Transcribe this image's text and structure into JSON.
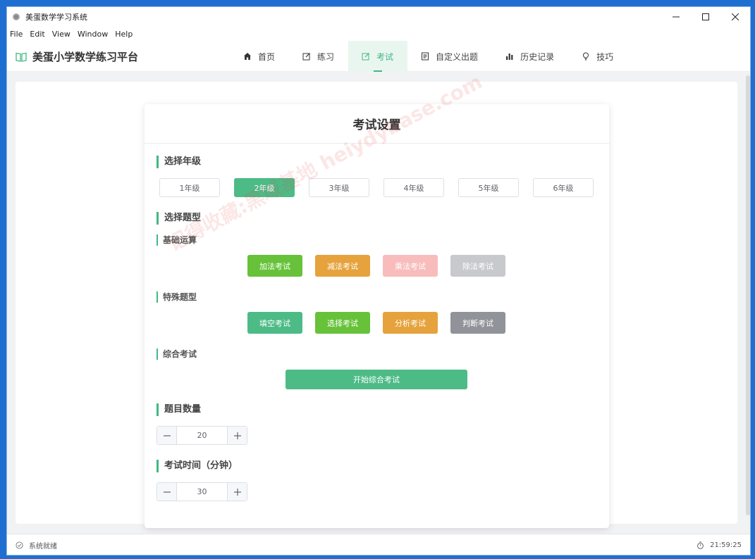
{
  "window": {
    "title": "美蛋数学学习系统"
  },
  "menu": [
    "File",
    "Edit",
    "View",
    "Window",
    "Help"
  ],
  "brand": {
    "name": "美蛋小学数学练习平台"
  },
  "nav": [
    {
      "label": "首页",
      "icon": "home-icon"
    },
    {
      "label": "练习",
      "icon": "edit-icon"
    },
    {
      "label": "考试",
      "icon": "edit-icon",
      "active": true
    },
    {
      "label": "自定义出题",
      "icon": "document-icon"
    },
    {
      "label": "历史记录",
      "icon": "bar-chart-icon"
    },
    {
      "label": "技巧",
      "icon": "lightbulb-icon"
    }
  ],
  "card": {
    "title": "考试设置",
    "grade_section": "选择年级",
    "grades": [
      "1年级",
      "2年级",
      "3年级",
      "4年级",
      "5年级",
      "6年级"
    ],
    "selected_grade": "2年级",
    "type_section": "选择题型",
    "basic": {
      "title": "基础运算",
      "buttons": [
        {
          "label": "加法考试",
          "color": "#67c23a"
        },
        {
          "label": "减法考试",
          "color": "#e6a23c"
        },
        {
          "label": "乘法考试",
          "color": "#f8bcbc"
        },
        {
          "label": "除法考试",
          "color": "#c8c9cc"
        }
      ]
    },
    "special": {
      "title": "特殊题型",
      "buttons": [
        {
          "label": "填空考试",
          "color": "#4dbb86"
        },
        {
          "label": "选择考试",
          "color": "#67c23a"
        },
        {
          "label": "分析考试",
          "color": "#e6a23c"
        },
        {
          "label": "判断考试",
          "color": "#909399"
        }
      ]
    },
    "combined": {
      "title": "综合考试",
      "button": "开始综合考试"
    },
    "count": {
      "title": "题目数量",
      "value": "20"
    },
    "time": {
      "title": "考试时间（分钟）",
      "value": "30"
    }
  },
  "status": {
    "left": "系统就绪",
    "time": "21:59:25"
  },
  "watermark": "记得收藏:黑域基地 heiydybase.com",
  "colors": {
    "accent": "#42b883"
  }
}
